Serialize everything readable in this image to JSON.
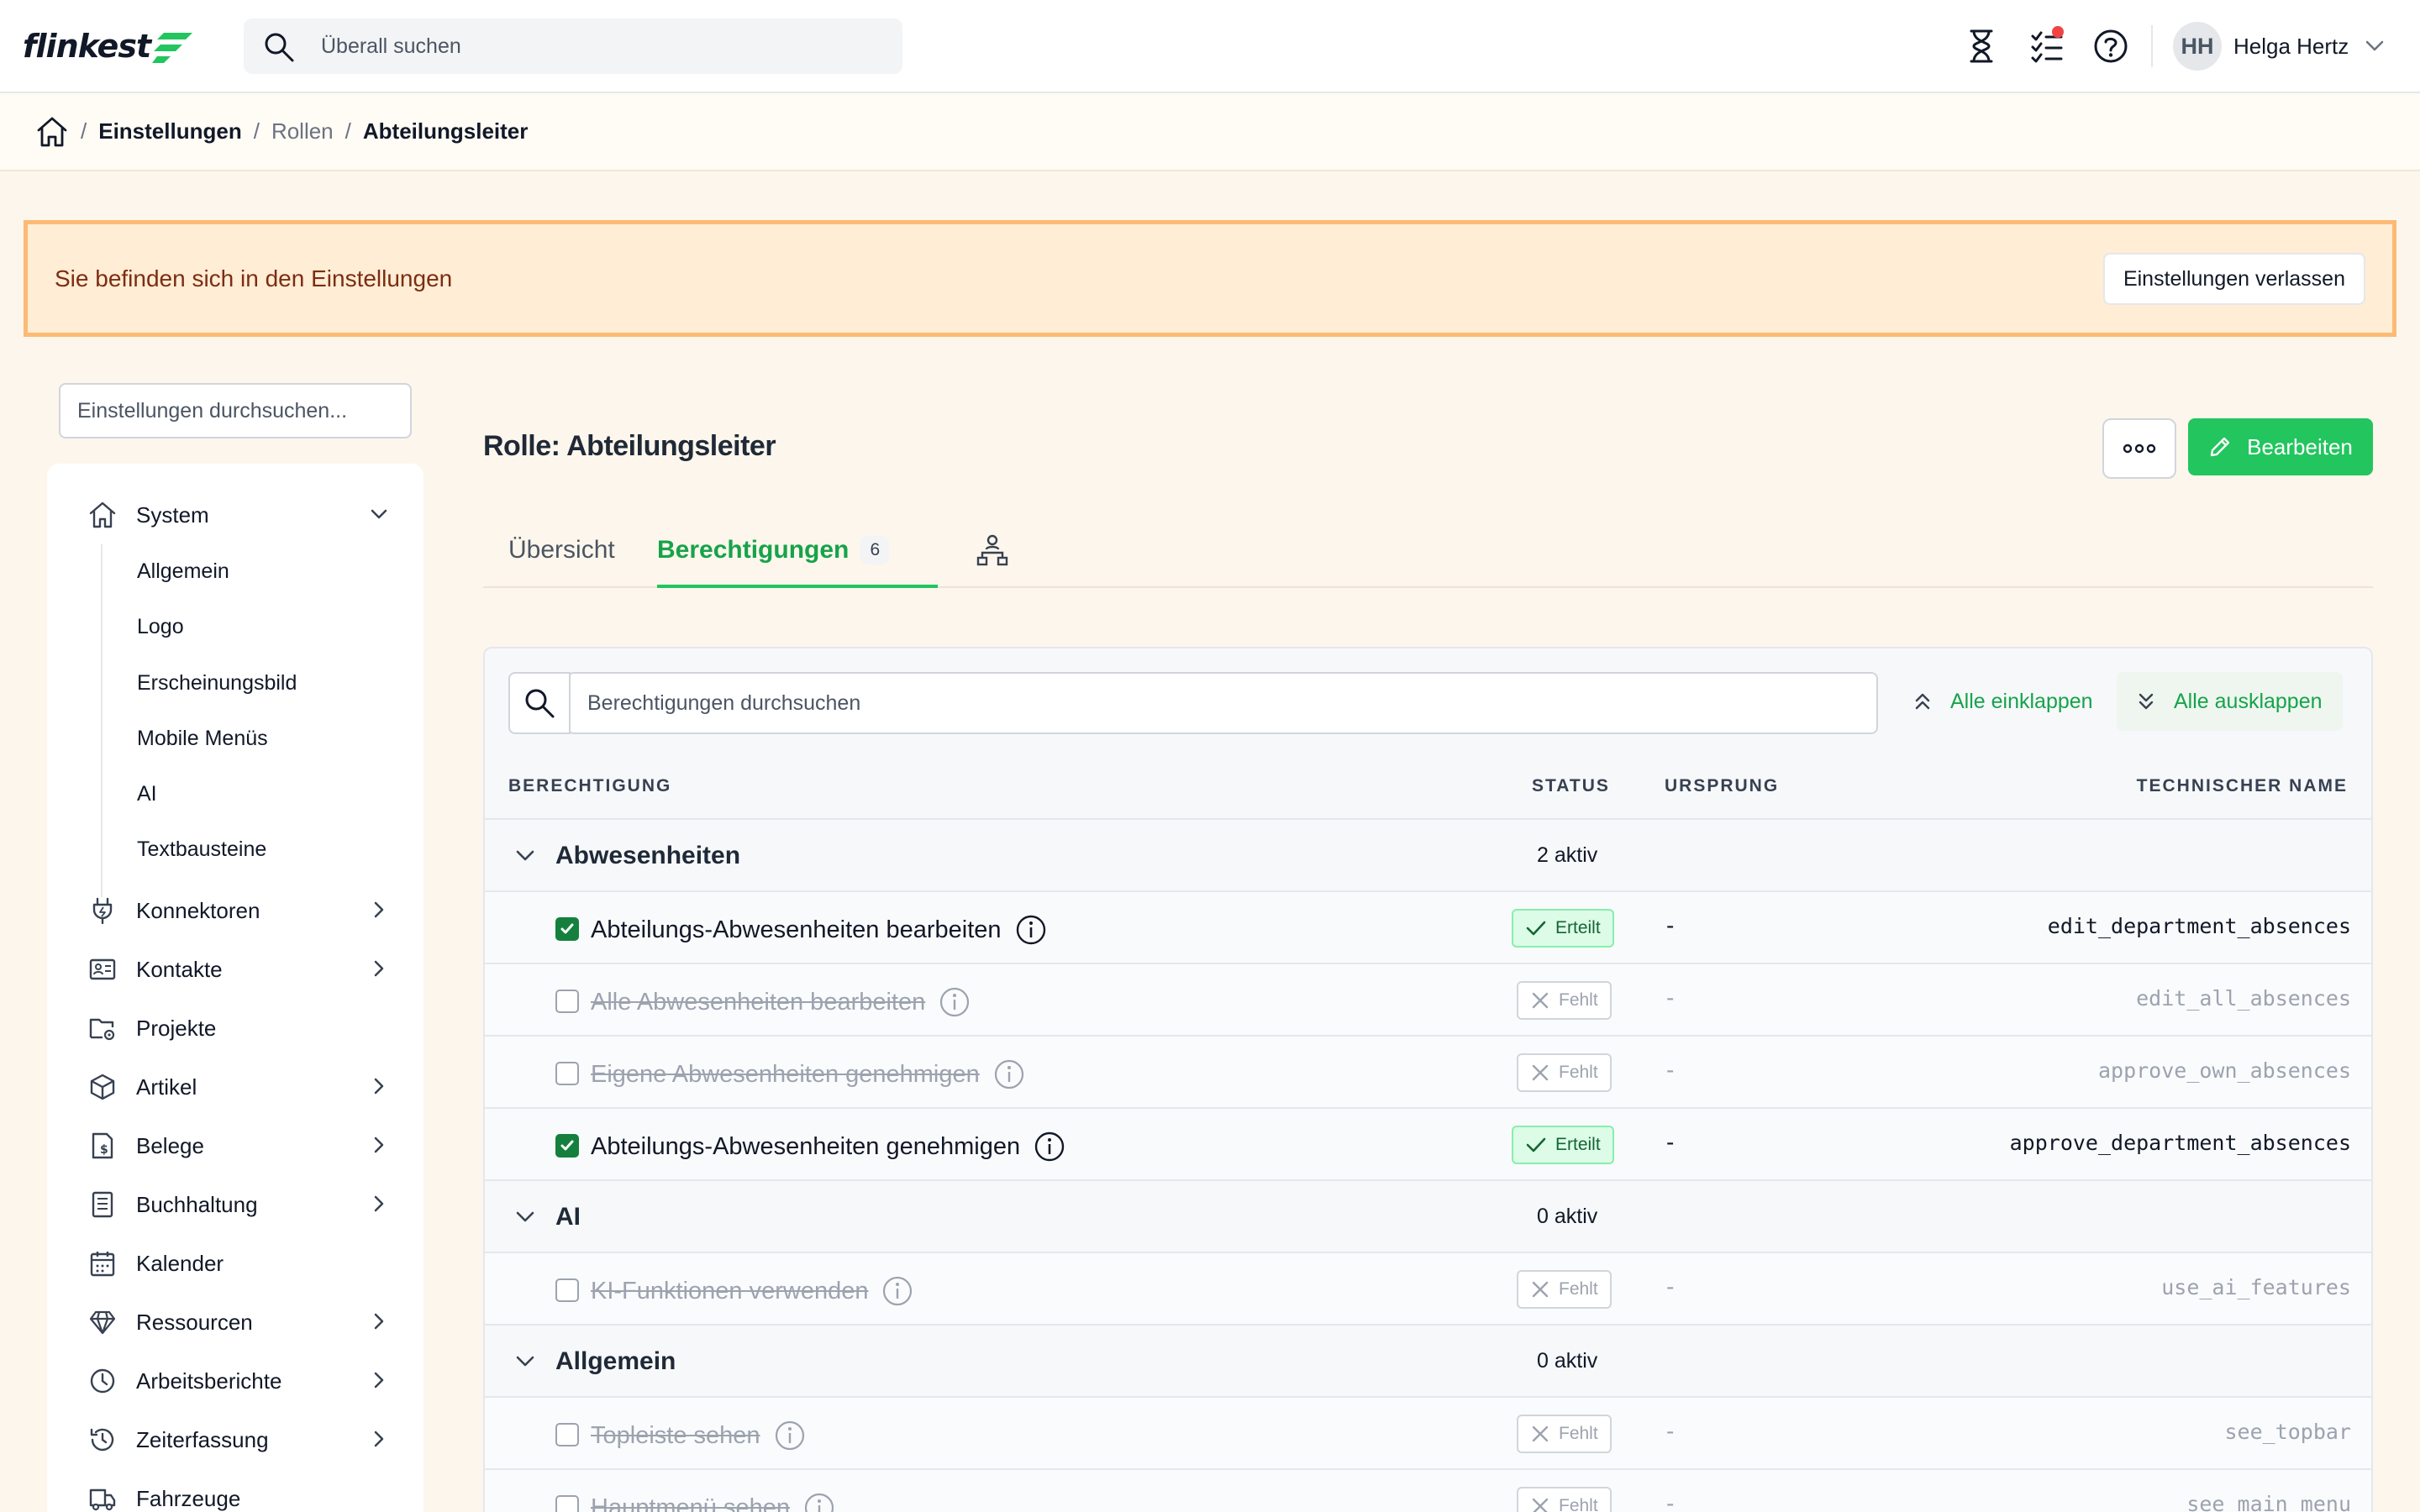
{
  "header": {
    "logo_text": "flinkest",
    "search_placeholder": "Überall suchen",
    "user_initials": "HH",
    "user_name": "Helga Hertz",
    "icons": [
      "hourglass-icon",
      "checklist-icon",
      "help-icon"
    ],
    "notification_color": "#ef4444"
  },
  "breadcrumb": {
    "items": [
      "Einstellungen",
      "Rollen",
      "Abteilungsleiter"
    ]
  },
  "banner": {
    "text": "Sie befinden sich in den Einstellungen",
    "button": "Einstellungen verlassen"
  },
  "sidebar": {
    "search_placeholder": "Einstellungen durchsuchen...",
    "system_label": "System",
    "system_sub": [
      "Allgemein",
      "Logo",
      "Erscheinungsbild",
      "Mobile Menüs",
      "AI",
      "Textbausteine"
    ],
    "items": [
      {
        "label": "Konnektoren",
        "icon": "plug-icon",
        "chevron": true
      },
      {
        "label": "Kontakte",
        "icon": "contact-card-icon",
        "chevron": true
      },
      {
        "label": "Projekte",
        "icon": "project-folder-icon",
        "chevron": false
      },
      {
        "label": "Artikel",
        "icon": "box-icon",
        "chevron": true
      },
      {
        "label": "Belege",
        "icon": "receipt-icon",
        "chevron": true
      },
      {
        "label": "Buchhaltung",
        "icon": "ledger-icon",
        "chevron": true
      },
      {
        "label": "Kalender",
        "icon": "calendar-icon",
        "chevron": false
      },
      {
        "label": "Ressourcen",
        "icon": "diamond-icon",
        "chevron": true
      },
      {
        "label": "Arbeitsberichte",
        "icon": "clock-icon",
        "chevron": true
      },
      {
        "label": "Zeiterfassung",
        "icon": "history-icon",
        "chevron": true
      },
      {
        "label": "Fahrzeuge",
        "icon": "truck-icon",
        "chevron": false
      }
    ]
  },
  "main": {
    "title": "Rolle: Abteilungsleiter",
    "edit_button": "Bearbeiten",
    "tabs": {
      "overview": "Übersicht",
      "permissions": "Berechtigungen",
      "permissions_count": "6"
    },
    "accent_color": "#22c55e"
  },
  "permissions": {
    "search_placeholder": "Berechtigungen durchsuchen",
    "collapse_all": "Alle einklappen",
    "expand_all": "Alle ausklappen",
    "columns": {
      "permission": "BERECHTIGUNG",
      "status": "STATUS",
      "origin": "URSPRUNG",
      "technical_name": "TECHNISCHER NAME"
    },
    "groups": [
      {
        "name": "Abwesenheiten",
        "count": "2 aktiv",
        "rows": [
          {
            "label": "Abteilungs-Abwesenheiten bearbeiten",
            "status": "Erteilt",
            "origin": "-",
            "tech": "edit_department_absences"
          },
          {
            "label": "Alle Abwesenheiten bearbeiten",
            "status": "Fehlt",
            "origin": "-",
            "tech": "edit_all_absences"
          },
          {
            "label": "Eigene Abwesenheiten genehmigen",
            "status": "Fehlt",
            "origin": "-",
            "tech": "approve_own_absences"
          },
          {
            "label": "Abteilungs-Abwesenheiten genehmigen",
            "status": "Erteilt",
            "origin": "-",
            "tech": "approve_department_absences"
          }
        ]
      },
      {
        "name": "AI",
        "count": "0 aktiv",
        "rows": [
          {
            "label": "KI-Funktionen verwenden",
            "status": "Fehlt",
            "origin": "-",
            "tech": "use_ai_features"
          }
        ]
      },
      {
        "name": "Allgemein",
        "count": "0 aktiv",
        "rows": [
          {
            "label": "Topleiste sehen",
            "status": "Fehlt",
            "origin": "-",
            "tech": "see_topbar"
          },
          {
            "label": "Hauptmenü sehen",
            "status": "Fehlt",
            "origin": "-",
            "tech": "see_main_menu"
          }
        ]
      }
    ]
  }
}
